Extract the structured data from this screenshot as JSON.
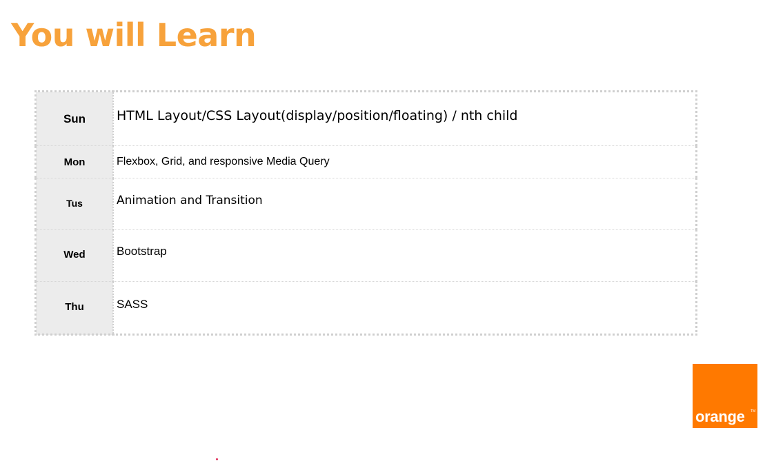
{
  "title": "You will Learn",
  "schedule": {
    "rows": [
      {
        "day": "Sun",
        "topic": "HTML Layout/CSS Layout(display/position/floating) / nth child"
      },
      {
        "day": "Mon",
        "topic": "Flexbox, Grid, and responsive Media Query"
      },
      {
        "day": "Tus",
        "topic": "Animation and Transition"
      },
      {
        "day": "Wed",
        "topic": "Bootstrap"
      },
      {
        "day": "Thu",
        "topic": "SASS"
      }
    ]
  },
  "logo": {
    "text": "orange",
    "trademark": "TM",
    "color": "#ff7900"
  },
  "colors": {
    "title": "#f7a23b",
    "day_cell_bg": "#ececec"
  }
}
